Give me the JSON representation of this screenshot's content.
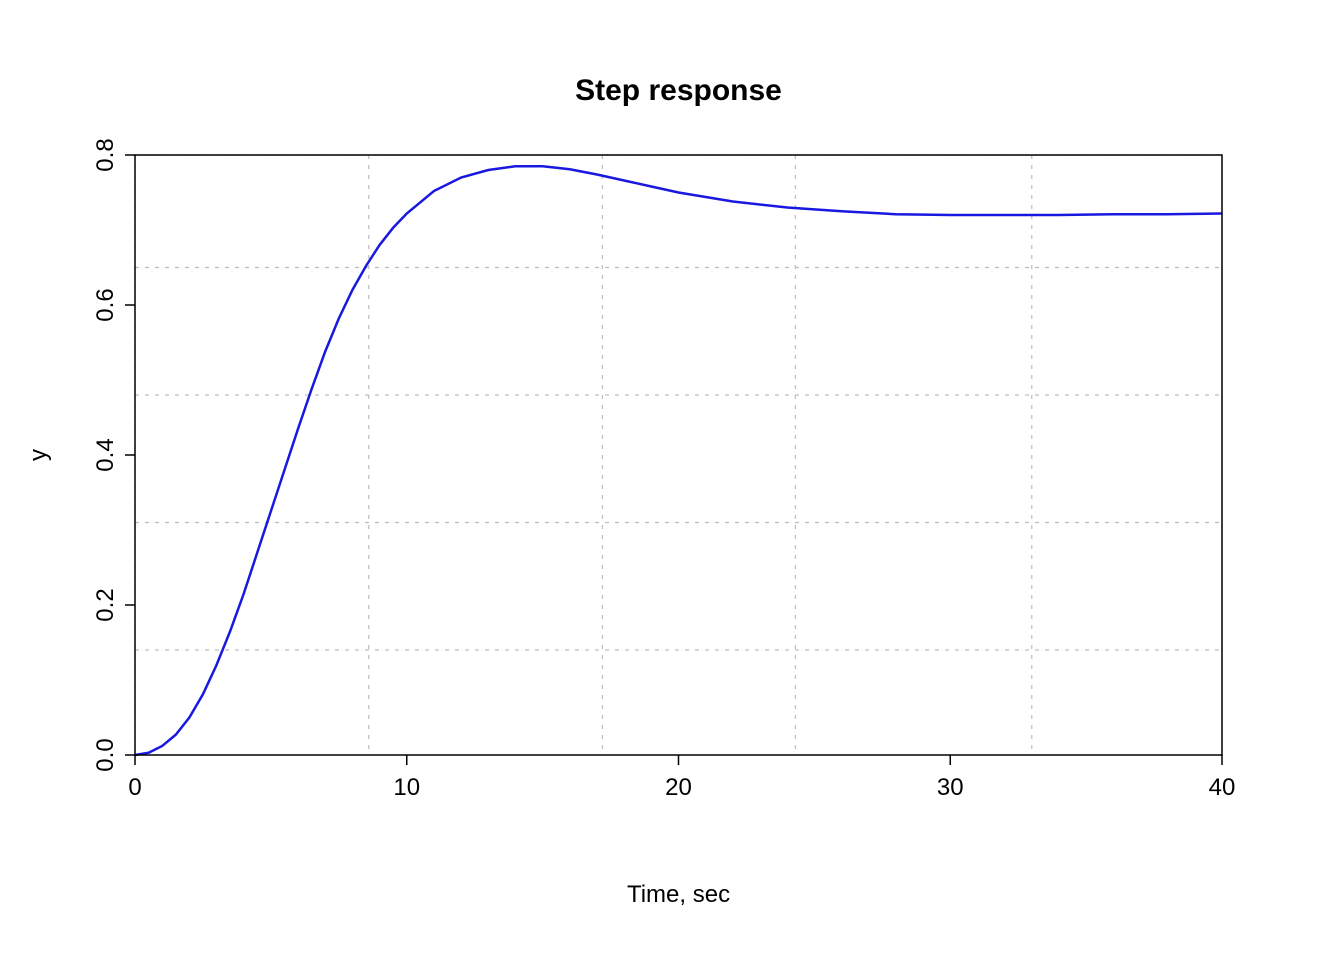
{
  "chart_data": {
    "type": "line",
    "title": "Step response",
    "xlabel": "Time, sec",
    "ylabel": "y",
    "xlim": [
      0,
      40
    ],
    "ylim": [
      0.0,
      0.8
    ],
    "x_ticks": [
      0,
      10,
      20,
      30,
      40
    ],
    "y_ticks": [
      0.0,
      0.2,
      0.4,
      0.6,
      0.8
    ],
    "vgrid_x": [
      0,
      8.6,
      17.2,
      24.3,
      33.0,
      40
    ],
    "hgrid_y": [
      0.14,
      0.31,
      0.48,
      0.65,
      0.8
    ],
    "x": [
      0,
      0.5,
      1,
      1.5,
      2,
      2.5,
      3,
      3.5,
      4,
      4.5,
      5,
      5.5,
      6,
      6.5,
      7,
      7.5,
      8,
      8.5,
      9,
      9.5,
      10,
      11,
      12,
      13,
      14,
      15,
      16,
      17,
      18,
      19,
      20,
      22,
      24,
      26,
      28,
      30,
      32,
      34,
      36,
      38,
      40
    ],
    "values": [
      0.0,
      0.003,
      0.012,
      0.027,
      0.05,
      0.081,
      0.12,
      0.165,
      0.215,
      0.27,
      0.325,
      0.38,
      0.435,
      0.488,
      0.538,
      0.582,
      0.62,
      0.652,
      0.68,
      0.703,
      0.722,
      0.752,
      0.77,
      0.78,
      0.785,
      0.785,
      0.781,
      0.774,
      0.766,
      0.758,
      0.75,
      0.738,
      0.73,
      0.725,
      0.721,
      0.72,
      0.72,
      0.72,
      0.721,
      0.721,
      0.722
    ]
  }
}
